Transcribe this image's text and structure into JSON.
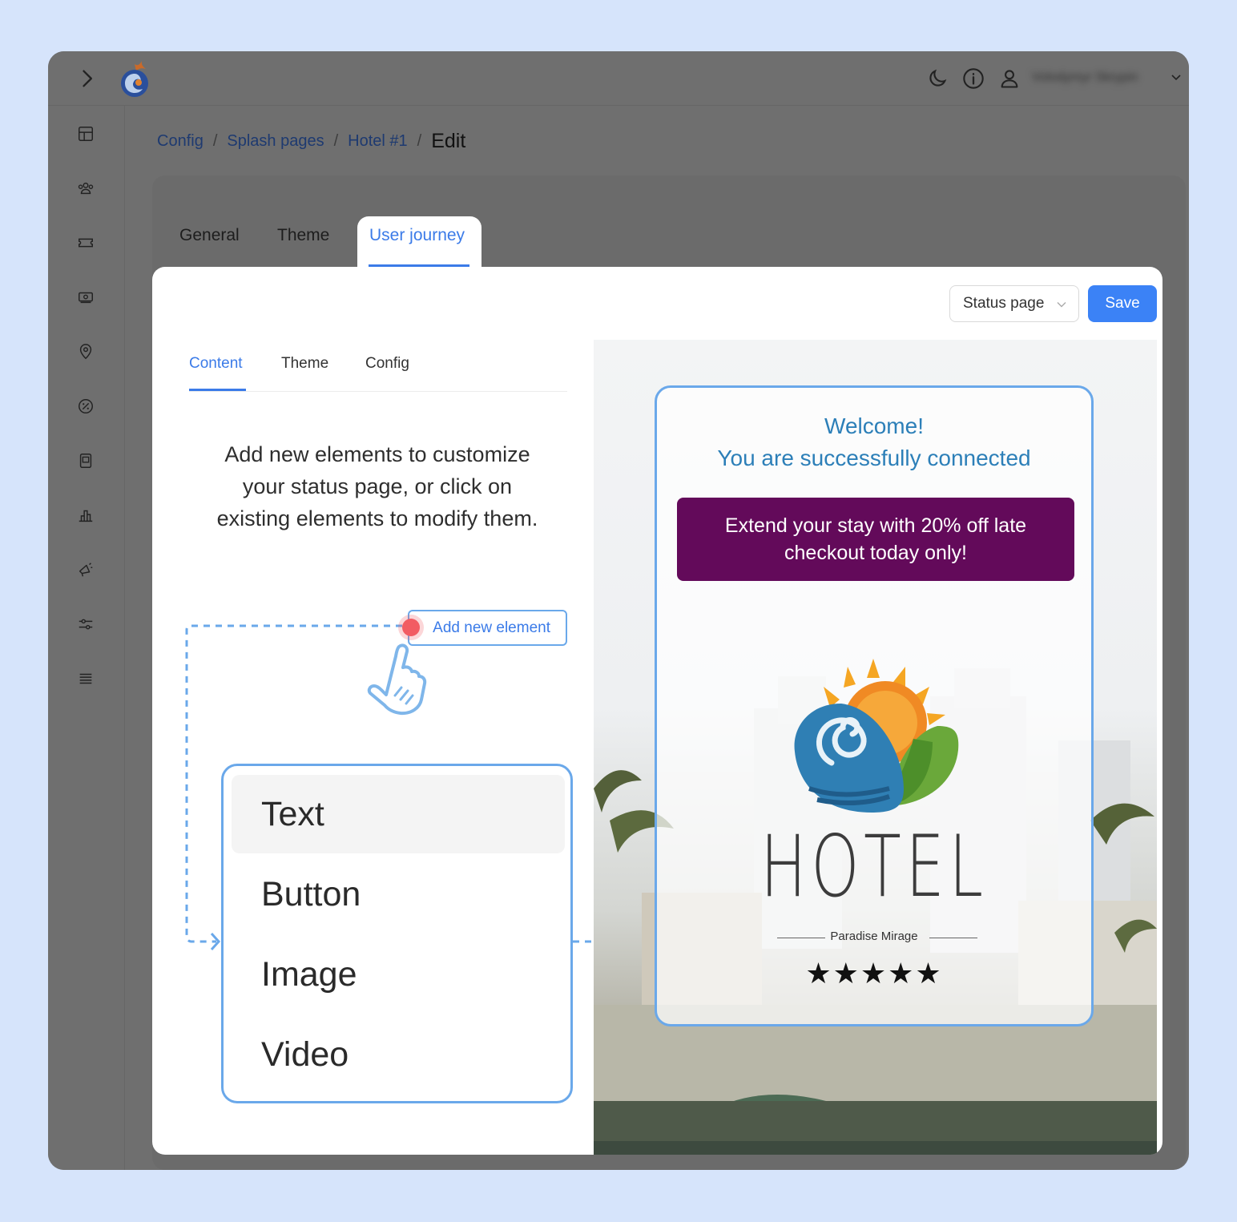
{
  "header": {
    "user_name": "Volodymyr Skrypin"
  },
  "breadcrumb": {
    "items": [
      "Config",
      "Splash pages",
      "Hotel #1"
    ],
    "separator": "/",
    "current": "Edit"
  },
  "page_tabs": [
    "General",
    "Theme",
    "User journey"
  ],
  "toolbar": {
    "select_value": "Status page",
    "save_label": "Save"
  },
  "editor_tabs": [
    "Content",
    "Theme",
    "Config"
  ],
  "instructions": "Add new elements to customize your status page, or click on existing elements to modify them.",
  "add_element_label": "Add new element",
  "element_menu": [
    "Text",
    "Button",
    "Image",
    "Video"
  ],
  "preview": {
    "welcome_line1": "Welcome!",
    "welcome_line2": "You are successfully connected",
    "promo_text": "Extend your stay with 20% off late checkout today only!",
    "hotel_name": "HOTEL",
    "hotel_subtitle": "Paradise Mirage",
    "stars": "★★★★★",
    "rating": 5
  },
  "colors": {
    "accent": "#3b82f6",
    "promo_bg": "#630a5a",
    "welcome_text": "#2c7fb8",
    "highlight_border": "#6aa8ea",
    "page_bg": "#d6e4fb"
  }
}
